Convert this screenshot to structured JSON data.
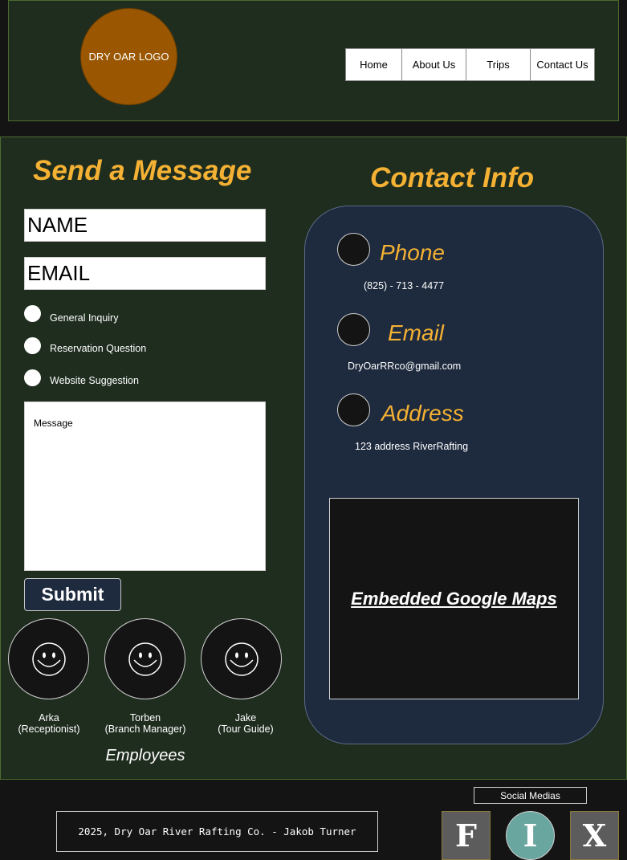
{
  "header": {
    "logo_text": "DRY OAR LOGO",
    "nav": [
      "Home",
      "About Us",
      "Trips",
      "Contact Us"
    ]
  },
  "form": {
    "title": "Send a Message",
    "name_placeholder": "NAME",
    "email_placeholder": "EMAIL",
    "options": [
      "General Inquiry",
      "Reservation Question",
      "Website Suggestion"
    ],
    "message_placeholder": "Message",
    "submit_label": "Submit"
  },
  "employees": {
    "title": "Employees",
    "people": [
      {
        "name": "Arka",
        "role": "(Receptionist)"
      },
      {
        "name": "Torben",
        "role": "(Branch Manager)"
      },
      {
        "name": "Jake",
        "role": "(Tour Guide)"
      }
    ]
  },
  "contact": {
    "title": "Contact Info",
    "phone_label": "Phone",
    "phone_value": "(825) - 713 - 4477",
    "email_label": "Email",
    "email_value": "DryOarRRco@gmail.com",
    "address_label": "Address",
    "address_value": "123 address RiverRafting",
    "map_label": "Embedded Google Maps "
  },
  "footer": {
    "copyright": "2025, Dry Oar River Rafting Co. - Jakob Turner",
    "social_title": "Social Medias",
    "social": [
      {
        "letter": "F",
        "icon": "facebook-icon"
      },
      {
        "letter": "I",
        "icon": "instagram-icon"
      },
      {
        "letter": "X",
        "icon": "x-icon"
      }
    ]
  }
}
